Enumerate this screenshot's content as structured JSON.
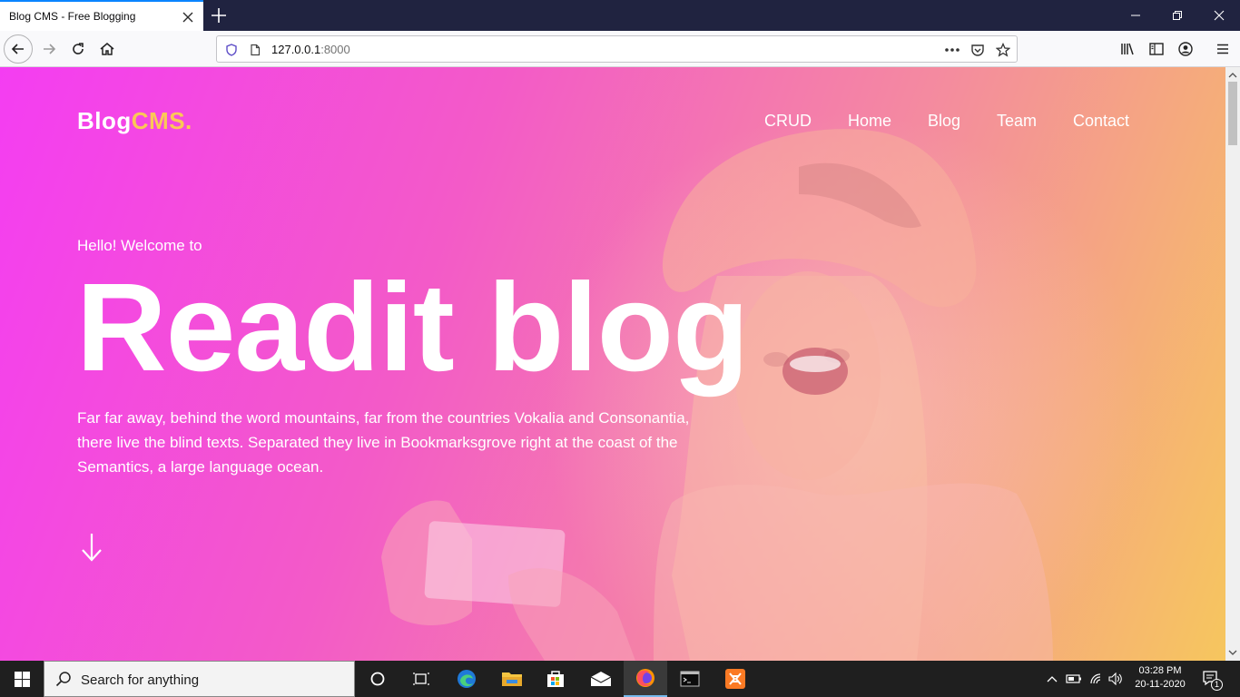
{
  "browser": {
    "tab_title": "Blog CMS - Free Blogging",
    "url_host": "127.0.0.1",
    "url_port": ":8000"
  },
  "site": {
    "brand_main": "Blog",
    "brand_accent": "CMS",
    "brand_dot": ".",
    "nav": [
      "CRUD",
      "Home",
      "Blog",
      "Team",
      "Contact"
    ],
    "greeting": "Hello! Welcome to",
    "hero_title": "Readit blog",
    "hero_description": "Far far away, behind the word mountains, far from the countries Vokalia and Consonantia, there live the blind texts. Separated they live in Bookmarksgrove right at the coast of the Semantics, a large language ocean."
  },
  "taskbar": {
    "search_placeholder": "Search for anything",
    "time": "03:28 PM",
    "date": "20-11-2020",
    "notification_count": "1"
  },
  "colors": {
    "accent": "#fbc856",
    "gradient_left": "#f43df2",
    "gradient_right": "#f6c65e",
    "tab_highlight": "#0a84ff"
  }
}
